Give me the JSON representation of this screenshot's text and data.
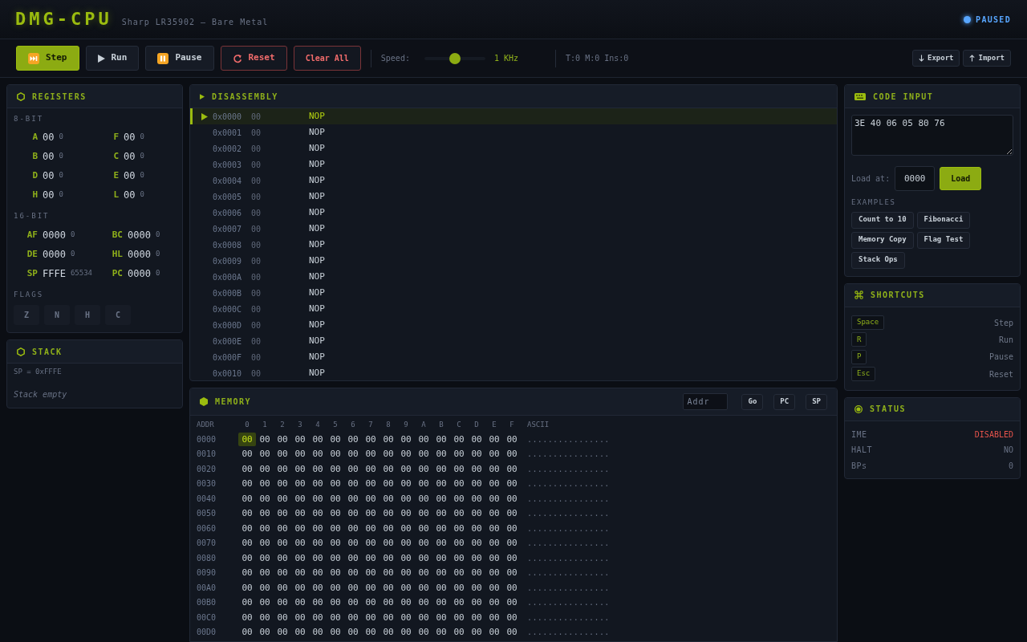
{
  "header": {
    "title": "DMG-CPU",
    "subtitle": "Sharp LR35902 — Bare Metal",
    "status": {
      "label": "PAUSED",
      "running": false
    }
  },
  "toolbar": {
    "step_button": {
      "label": "Step"
    },
    "run_button": {
      "label": "Run"
    },
    "pause_button": {
      "label": "Pause"
    },
    "reset_button": {
      "label": "Reset"
    },
    "clear_button": {
      "label": "Clear All"
    },
    "speed": {
      "label": "Speed:",
      "level": 0.5,
      "reading": "1 KHz"
    },
    "counters": "T:0 M:0 Ins:0",
    "export_button": {
      "label": "Export"
    },
    "import_button": {
      "label": "Import"
    }
  },
  "registers": {
    "title": "REGISTERS",
    "eight_bit": {
      "label": "8-BIT",
      "items": [
        {
          "name": "A",
          "hex": "00",
          "decimal": "0"
        },
        {
          "name": "F",
          "hex": "00",
          "decimal": "0"
        },
        {
          "name": "B",
          "hex": "00",
          "decimal": "0"
        },
        {
          "name": "C",
          "hex": "00",
          "decimal": "0"
        },
        {
          "name": "D",
          "hex": "00",
          "decimal": "0"
        },
        {
          "name": "E",
          "hex": "00",
          "decimal": "0"
        },
        {
          "name": "H",
          "hex": "00",
          "decimal": "0"
        },
        {
          "name": "L",
          "hex": "00",
          "decimal": "0"
        }
      ]
    },
    "sixteen_bit": {
      "label": "16-BIT",
      "items": [
        {
          "name": "AF",
          "hex": "0000",
          "decimal": "0"
        },
        {
          "name": "BC",
          "hex": "0000",
          "decimal": "0"
        },
        {
          "name": "DE",
          "hex": "0000",
          "decimal": "0"
        },
        {
          "name": "HL",
          "hex": "0000",
          "decimal": "0"
        },
        {
          "name": "SP",
          "hex": "FFFE",
          "decimal": "65534"
        },
        {
          "name": "PC",
          "hex": "0000",
          "decimal": "0"
        }
      ]
    },
    "flags": {
      "label": "FLAGS",
      "items": [
        {
          "name": "Z",
          "set": false
        },
        {
          "name": "N",
          "set": false
        },
        {
          "name": "H",
          "set": false
        },
        {
          "name": "C",
          "set": false
        }
      ]
    }
  },
  "stack": {
    "title": "STACK",
    "pointer": "SP = 0xFFFE",
    "empty_text": "Stack empty"
  },
  "disassembly": {
    "title": "DISASSEMBLY",
    "rows": [
      {
        "address": "0x0000",
        "bytes": "00",
        "mnemonic": "NOP",
        "current": true
      },
      {
        "address": "0x0001",
        "bytes": "00",
        "mnemonic": "NOP",
        "current": false
      },
      {
        "address": "0x0002",
        "bytes": "00",
        "mnemonic": "NOP",
        "current": false
      },
      {
        "address": "0x0003",
        "bytes": "00",
        "mnemonic": "NOP",
        "current": false
      },
      {
        "address": "0x0004",
        "bytes": "00",
        "mnemonic": "NOP",
        "current": false
      },
      {
        "address": "0x0005",
        "bytes": "00",
        "mnemonic": "NOP",
        "current": false
      },
      {
        "address": "0x0006",
        "bytes": "00",
        "mnemonic": "NOP",
        "current": false
      },
      {
        "address": "0x0007",
        "bytes": "00",
        "mnemonic": "NOP",
        "current": false
      },
      {
        "address": "0x0008",
        "bytes": "00",
        "mnemonic": "NOP",
        "current": false
      },
      {
        "address": "0x0009",
        "bytes": "00",
        "mnemonic": "NOP",
        "current": false
      },
      {
        "address": "0x000A",
        "bytes": "00",
        "mnemonic": "NOP",
        "current": false
      },
      {
        "address": "0x000B",
        "bytes": "00",
        "mnemonic": "NOP",
        "current": false
      },
      {
        "address": "0x000C",
        "bytes": "00",
        "mnemonic": "NOP",
        "current": false
      },
      {
        "address": "0x000D",
        "bytes": "00",
        "mnemonic": "NOP",
        "current": false
      },
      {
        "address": "0x000E",
        "bytes": "00",
        "mnemonic": "NOP",
        "current": false
      },
      {
        "address": "0x000F",
        "bytes": "00",
        "mnemonic": "NOP",
        "current": false
      },
      {
        "address": "0x0010",
        "bytes": "00",
        "mnemonic": "NOP",
        "current": false
      }
    ]
  },
  "memory": {
    "title": "MEMORY",
    "address_field": {
      "placeholder": "Addr"
    },
    "buttons": [
      "Go",
      "PC",
      "SP"
    ],
    "address_heading": "ADDR",
    "byte_headings": [
      "0",
      "1",
      "2",
      "3",
      "4",
      "5",
      "6",
      "7",
      "8",
      "9",
      "A",
      "B",
      "C",
      "D",
      "E",
      "F"
    ],
    "ascii_heading": "ASCII",
    "rows": [
      {
        "address": "0000",
        "cells": [
          {
            "value": "00",
            "selected": true
          },
          {
            "value": "00",
            "selected": false
          },
          {
            "value": "00",
            "selected": false
          },
          {
            "value": "00",
            "selected": false
          },
          {
            "value": "00",
            "selected": false
          },
          {
            "value": "00",
            "selected": false
          },
          {
            "value": "00",
            "selected": false
          },
          {
            "value": "00",
            "selected": false
          },
          {
            "value": "00",
            "selected": false
          },
          {
            "value": "00",
            "selected": false
          },
          {
            "value": "00",
            "selected": false
          },
          {
            "value": "00",
            "selected": false
          },
          {
            "value": "00",
            "selected": false
          },
          {
            "value": "00",
            "selected": false
          },
          {
            "value": "00",
            "selected": false
          },
          {
            "value": "00",
            "selected": false
          }
        ],
        "ascii": "................"
      },
      {
        "address": "0010",
        "cells": [
          {
            "value": "00",
            "selected": false
          },
          {
            "value": "00",
            "selected": false
          },
          {
            "value": "00",
            "selected": false
          },
          {
            "value": "00",
            "selected": false
          },
          {
            "value": "00",
            "selected": false
          },
          {
            "value": "00",
            "selected": false
          },
          {
            "value": "00",
            "selected": false
          },
          {
            "value": "00",
            "selected": false
          },
          {
            "value": "00",
            "selected": false
          },
          {
            "value": "00",
            "selected": false
          },
          {
            "value": "00",
            "selected": false
          },
          {
            "value": "00",
            "selected": false
          },
          {
            "value": "00",
            "selected": false
          },
          {
            "value": "00",
            "selected": false
          },
          {
            "value": "00",
            "selected": false
          },
          {
            "value": "00",
            "selected": false
          }
        ],
        "ascii": "................"
      },
      {
        "address": "0020",
        "cells": [
          {
            "value": "00",
            "selected": false
          },
          {
            "value": "00",
            "selected": false
          },
          {
            "value": "00",
            "selected": false
          },
          {
            "value": "00",
            "selected": false
          },
          {
            "value": "00",
            "selected": false
          },
          {
            "value": "00",
            "selected": false
          },
          {
            "value": "00",
            "selected": false
          },
          {
            "value": "00",
            "selected": false
          },
          {
            "value": "00",
            "selected": false
          },
          {
            "value": "00",
            "selected": false
          },
          {
            "value": "00",
            "selected": false
          },
          {
            "value": "00",
            "selected": false
          },
          {
            "value": "00",
            "selected": false
          },
          {
            "value": "00",
            "selected": false
          },
          {
            "value": "00",
            "selected": false
          },
          {
            "value": "00",
            "selected": false
          }
        ],
        "ascii": "................"
      },
      {
        "address": "0030",
        "cells": [
          {
            "value": "00",
            "selected": false
          },
          {
            "value": "00",
            "selected": false
          },
          {
            "value": "00",
            "selected": false
          },
          {
            "value": "00",
            "selected": false
          },
          {
            "value": "00",
            "selected": false
          },
          {
            "value": "00",
            "selected": false
          },
          {
            "value": "00",
            "selected": false
          },
          {
            "value": "00",
            "selected": false
          },
          {
            "value": "00",
            "selected": false
          },
          {
            "value": "00",
            "selected": false
          },
          {
            "value": "00",
            "selected": false
          },
          {
            "value": "00",
            "selected": false
          },
          {
            "value": "00",
            "selected": false
          },
          {
            "value": "00",
            "selected": false
          },
          {
            "value": "00",
            "selected": false
          },
          {
            "value": "00",
            "selected": false
          }
        ],
        "ascii": "................"
      },
      {
        "address": "0040",
        "cells": [
          {
            "value": "00",
            "selected": false
          },
          {
            "value": "00",
            "selected": false
          },
          {
            "value": "00",
            "selected": false
          },
          {
            "value": "00",
            "selected": false
          },
          {
            "value": "00",
            "selected": false
          },
          {
            "value": "00",
            "selected": false
          },
          {
            "value": "00",
            "selected": false
          },
          {
            "value": "00",
            "selected": false
          },
          {
            "value": "00",
            "selected": false
          },
          {
            "value": "00",
            "selected": false
          },
          {
            "value": "00",
            "selected": false
          },
          {
            "value": "00",
            "selected": false
          },
          {
            "value": "00",
            "selected": false
          },
          {
            "value": "00",
            "selected": false
          },
          {
            "value": "00",
            "selected": false
          },
          {
            "value": "00",
            "selected": false
          }
        ],
        "ascii": "................"
      },
      {
        "address": "0050",
        "cells": [
          {
            "value": "00",
            "selected": false
          },
          {
            "value": "00",
            "selected": false
          },
          {
            "value": "00",
            "selected": false
          },
          {
            "value": "00",
            "selected": false
          },
          {
            "value": "00",
            "selected": false
          },
          {
            "value": "00",
            "selected": false
          },
          {
            "value": "00",
            "selected": false
          },
          {
            "value": "00",
            "selected": false
          },
          {
            "value": "00",
            "selected": false
          },
          {
            "value": "00",
            "selected": false
          },
          {
            "value": "00",
            "selected": false
          },
          {
            "value": "00",
            "selected": false
          },
          {
            "value": "00",
            "selected": false
          },
          {
            "value": "00",
            "selected": false
          },
          {
            "value": "00",
            "selected": false
          },
          {
            "value": "00",
            "selected": false
          }
        ],
        "ascii": "................"
      },
      {
        "address": "0060",
        "cells": [
          {
            "value": "00",
            "selected": false
          },
          {
            "value": "00",
            "selected": false
          },
          {
            "value": "00",
            "selected": false
          },
          {
            "value": "00",
            "selected": false
          },
          {
            "value": "00",
            "selected": false
          },
          {
            "value": "00",
            "selected": false
          },
          {
            "value": "00",
            "selected": false
          },
          {
            "value": "00",
            "selected": false
          },
          {
            "value": "00",
            "selected": false
          },
          {
            "value": "00",
            "selected": false
          },
          {
            "value": "00",
            "selected": false
          },
          {
            "value": "00",
            "selected": false
          },
          {
            "value": "00",
            "selected": false
          },
          {
            "value": "00",
            "selected": false
          },
          {
            "value": "00",
            "selected": false
          },
          {
            "value": "00",
            "selected": false
          }
        ],
        "ascii": "................"
      },
      {
        "address": "0070",
        "cells": [
          {
            "value": "00",
            "selected": false
          },
          {
            "value": "00",
            "selected": false
          },
          {
            "value": "00",
            "selected": false
          },
          {
            "value": "00",
            "selected": false
          },
          {
            "value": "00",
            "selected": false
          },
          {
            "value": "00",
            "selected": false
          },
          {
            "value": "00",
            "selected": false
          },
          {
            "value": "00",
            "selected": false
          },
          {
            "value": "00",
            "selected": false
          },
          {
            "value": "00",
            "selected": false
          },
          {
            "value": "00",
            "selected": false
          },
          {
            "value": "00",
            "selected": false
          },
          {
            "value": "00",
            "selected": false
          },
          {
            "value": "00",
            "selected": false
          },
          {
            "value": "00",
            "selected": false
          },
          {
            "value": "00",
            "selected": false
          }
        ],
        "ascii": "................"
      },
      {
        "address": "0080",
        "cells": [
          {
            "value": "00",
            "selected": false
          },
          {
            "value": "00",
            "selected": false
          },
          {
            "value": "00",
            "selected": false
          },
          {
            "value": "00",
            "selected": false
          },
          {
            "value": "00",
            "selected": false
          },
          {
            "value": "00",
            "selected": false
          },
          {
            "value": "00",
            "selected": false
          },
          {
            "value": "00",
            "selected": false
          },
          {
            "value": "00",
            "selected": false
          },
          {
            "value": "00",
            "selected": false
          },
          {
            "value": "00",
            "selected": false
          },
          {
            "value": "00",
            "selected": false
          },
          {
            "value": "00",
            "selected": false
          },
          {
            "value": "00",
            "selected": false
          },
          {
            "value": "00",
            "selected": false
          },
          {
            "value": "00",
            "selected": false
          }
        ],
        "ascii": "................"
      },
      {
        "address": "0090",
        "cells": [
          {
            "value": "00",
            "selected": false
          },
          {
            "value": "00",
            "selected": false
          },
          {
            "value": "00",
            "selected": false
          },
          {
            "value": "00",
            "selected": false
          },
          {
            "value": "00",
            "selected": false
          },
          {
            "value": "00",
            "selected": false
          },
          {
            "value": "00",
            "selected": false
          },
          {
            "value": "00",
            "selected": false
          },
          {
            "value": "00",
            "selected": false
          },
          {
            "value": "00",
            "selected": false
          },
          {
            "value": "00",
            "selected": false
          },
          {
            "value": "00",
            "selected": false
          },
          {
            "value": "00",
            "selected": false
          },
          {
            "value": "00",
            "selected": false
          },
          {
            "value": "00",
            "selected": false
          },
          {
            "value": "00",
            "selected": false
          }
        ],
        "ascii": "................"
      },
      {
        "address": "00A0",
        "cells": [
          {
            "value": "00",
            "selected": false
          },
          {
            "value": "00",
            "selected": false
          },
          {
            "value": "00",
            "selected": false
          },
          {
            "value": "00",
            "selected": false
          },
          {
            "value": "00",
            "selected": false
          },
          {
            "value": "00",
            "selected": false
          },
          {
            "value": "00",
            "selected": false
          },
          {
            "value": "00",
            "selected": false
          },
          {
            "value": "00",
            "selected": false
          },
          {
            "value": "00",
            "selected": false
          },
          {
            "value": "00",
            "selected": false
          },
          {
            "value": "00",
            "selected": false
          },
          {
            "value": "00",
            "selected": false
          },
          {
            "value": "00",
            "selected": false
          },
          {
            "value": "00",
            "selected": false
          },
          {
            "value": "00",
            "selected": false
          }
        ],
        "ascii": "................"
      },
      {
        "address": "00B0",
        "cells": [
          {
            "value": "00",
            "selected": false
          },
          {
            "value": "00",
            "selected": false
          },
          {
            "value": "00",
            "selected": false
          },
          {
            "value": "00",
            "selected": false
          },
          {
            "value": "00",
            "selected": false
          },
          {
            "value": "00",
            "selected": false
          },
          {
            "value": "00",
            "selected": false
          },
          {
            "value": "00",
            "selected": false
          },
          {
            "value": "00",
            "selected": false
          },
          {
            "value": "00",
            "selected": false
          },
          {
            "value": "00",
            "selected": false
          },
          {
            "value": "00",
            "selected": false
          },
          {
            "value": "00",
            "selected": false
          },
          {
            "value": "00",
            "selected": false
          },
          {
            "value": "00",
            "selected": false
          },
          {
            "value": "00",
            "selected": false
          }
        ],
        "ascii": "................"
      },
      {
        "address": "00C0",
        "cells": [
          {
            "value": "00",
            "selected": false
          },
          {
            "value": "00",
            "selected": false
          },
          {
            "value": "00",
            "selected": false
          },
          {
            "value": "00",
            "selected": false
          },
          {
            "value": "00",
            "selected": false
          },
          {
            "value": "00",
            "selected": false
          },
          {
            "value": "00",
            "selected": false
          },
          {
            "value": "00",
            "selected": false
          },
          {
            "value": "00",
            "selected": false
          },
          {
            "value": "00",
            "selected": false
          },
          {
            "value": "00",
            "selected": false
          },
          {
            "value": "00",
            "selected": false
          },
          {
            "value": "00",
            "selected": false
          },
          {
            "value": "00",
            "selected": false
          },
          {
            "value": "00",
            "selected": false
          },
          {
            "value": "00",
            "selected": false
          }
        ],
        "ascii": "................"
      },
      {
        "address": "00D0",
        "cells": [
          {
            "value": "00",
            "selected": false
          },
          {
            "value": "00",
            "selected": false
          },
          {
            "value": "00",
            "selected": false
          },
          {
            "value": "00",
            "selected": false
          },
          {
            "value": "00",
            "selected": false
          },
          {
            "value": "00",
            "selected": false
          },
          {
            "value": "00",
            "selected": false
          },
          {
            "value": "00",
            "selected": false
          },
          {
            "value": "00",
            "selected": false
          },
          {
            "value": "00",
            "selected": false
          },
          {
            "value": "00",
            "selected": false
          },
          {
            "value": "00",
            "selected": false
          },
          {
            "value": "00",
            "selected": false
          },
          {
            "value": "00",
            "selected": false
          },
          {
            "value": "00",
            "selected": false
          },
          {
            "value": "00",
            "selected": false
          }
        ],
        "ascii": "................"
      }
    ]
  },
  "code_input": {
    "title": "CODE INPUT",
    "code": "3E 40 06 05 80 76",
    "load_label": "Load at:",
    "load_address": "0000",
    "load_button": "Load",
    "examples_label": "EXAMPLES",
    "examples": [
      "Count to 10",
      "Fibonacci",
      "Memory Copy",
      "Flag Test",
      "Stack Ops"
    ]
  },
  "shortcuts": {
    "title": "SHORTCUTS",
    "items": [
      {
        "key": "Space",
        "action": "Step"
      },
      {
        "key": "R",
        "action": "Run"
      },
      {
        "key": "P",
        "action": "Pause"
      },
      {
        "key": "Esc",
        "action": "Reset"
      }
    ]
  },
  "status": {
    "title": "STATUS",
    "items": [
      {
        "label": "IME",
        "value": "DISABLED",
        "warning": true
      },
      {
        "label": "HALT",
        "value": "NO",
        "warning": false
      },
      {
        "label": "BPs",
        "value": "0",
        "warning": false
      }
    ]
  }
}
